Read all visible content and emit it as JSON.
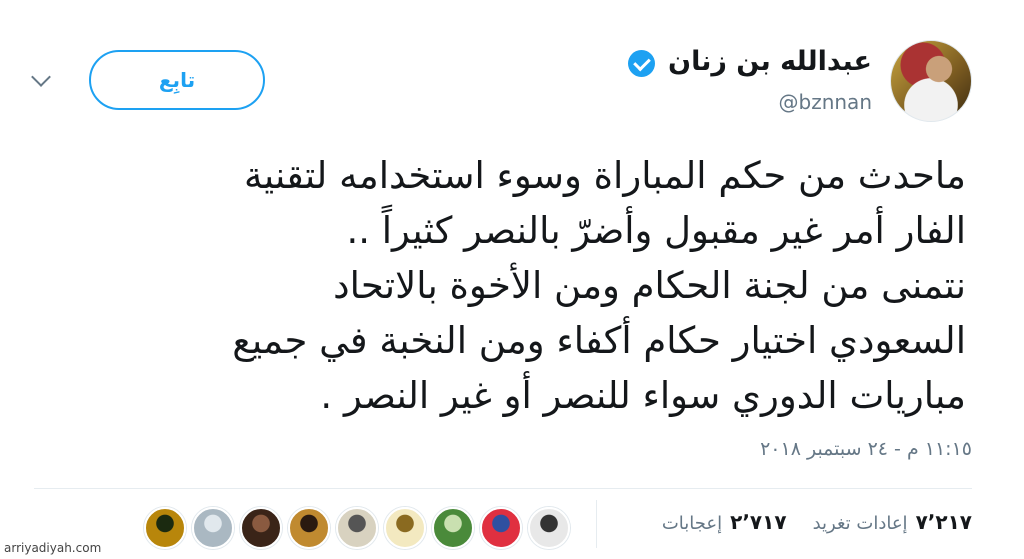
{
  "user": {
    "display_name": "عبدالله بن زنان",
    "handle": "@bznnan",
    "avatar_icon": "profile-photo"
  },
  "follow_label": "تابِع",
  "tweet": {
    "text": "ماحدث من حكم المباراة وسوء استخدامه لتقنية\nالفار أمر غير مقبول وأضرّ بالنصر كثيراً ..\nنتمنى من لجنة الحكام ومن الأخوة بالاتحاد\nالسعودي اختيار حكام أكفاء ومن النخبة في جميع\nمباريات الدوري سواء للنصر أو غير النصر .",
    "timestamp": "١١:١٥ م - ٢٤ سبتمبر ٢٠١٨"
  },
  "stats": {
    "retweets_count": "٧٬٢١٧",
    "retweets_label": "إعادات تغريد",
    "likes_count": "٢٬٧١٧",
    "likes_label": "إعجابات"
  },
  "likers": [
    {
      "name": "liker-avatar-1",
      "colors": [
        "#b8860b",
        "#1b2a10"
      ]
    },
    {
      "name": "liker-avatar-2",
      "colors": [
        "#aab8c2",
        "#e1e8ed"
      ]
    },
    {
      "name": "liker-avatar-3",
      "colors": [
        "#3a2418",
        "#8a5a40"
      ]
    },
    {
      "name": "liker-avatar-4",
      "colors": [
        "#c08a30",
        "#2a1a10"
      ]
    },
    {
      "name": "liker-avatar-5",
      "colors": [
        "#d8d2c0",
        "#555"
      ]
    },
    {
      "name": "liker-avatar-6",
      "colors": [
        "#f3e9c0",
        "#8a6a20"
      ]
    },
    {
      "name": "liker-avatar-7",
      "colors": [
        "#4a8a3a",
        "#c9e0b0"
      ]
    },
    {
      "name": "liker-avatar-8",
      "colors": [
        "#e03040",
        "#3050a0"
      ]
    },
    {
      "name": "liker-avatar-9",
      "colors": [
        "#e8e8e8",
        "#333"
      ]
    }
  ],
  "watermark": "arriyadiyah.com"
}
